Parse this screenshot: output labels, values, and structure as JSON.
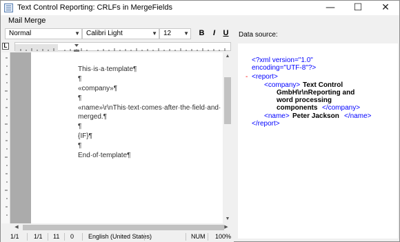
{
  "window": {
    "title": "Text Control Reporting: CRLFs in MergeFields",
    "minimize": "—",
    "maximize": "☐",
    "close": "✕"
  },
  "menu": {
    "mail_merge": "Mail Merge"
  },
  "toolbar": {
    "style": "Normal",
    "font": "Calibri Light",
    "size": "12",
    "bold": "B",
    "italic": "I",
    "underline": "U",
    "arrow": "▼"
  },
  "ruler": {
    "tab_marker": "L"
  },
  "document": {
    "lines": [
      "This·is·a·template¶",
      "¶",
      "«company»¶",
      "¶",
      "«name»\\r\\nThis·text·comes·after·the·field·and·",
      "merged.¶",
      "¶",
      "{IF}¶",
      "¶",
      "End·of·template¶"
    ]
  },
  "status": {
    "page": "1/1",
    "section": "1/1",
    "line": "11",
    "column": "0",
    "language": "English (United States)",
    "num": "NUM",
    "zoom": "100%"
  },
  "datasource": {
    "label": "Data source:",
    "decl1": "<?xml version=\"1.0\"",
    "decl2": "encoding=\"UTF-8\"?>",
    "collapse": "-",
    "report_open": "<report>",
    "company_open": "<company>",
    "company_text1": "Text Control",
    "company_text2": "GmbH\\r\\nReporting and",
    "company_text3": "word processing",
    "company_text4": "components",
    "company_close": "</company>",
    "name_open": "<name>",
    "name_text": "Peter Jackson",
    "name_close": "</name>",
    "report_close": "</report>"
  }
}
